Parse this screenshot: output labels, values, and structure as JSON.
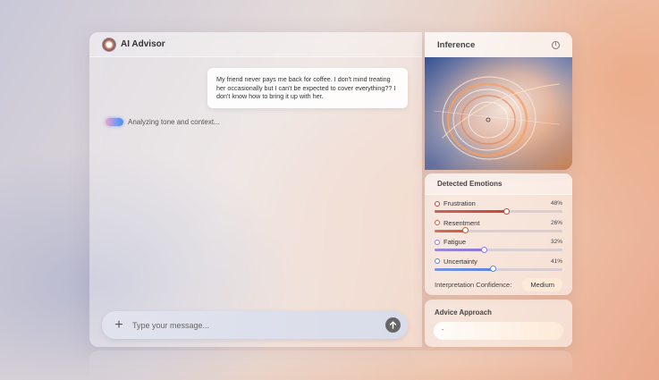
{
  "chat": {
    "title": "AI Advisor",
    "user_message": "My friend never pays me back for coffee. I don't mind treating her occasionally but I can't be expected to cover everything?? I don't know how to bring it up with her.",
    "status_text": "Analyzing tone and context...",
    "input_placeholder": "Type your message..."
  },
  "inference": {
    "title": "Inference",
    "info_icon": "i"
  },
  "emotions": {
    "title": "Detected Emotions",
    "items": [
      {
        "name": "Frustration",
        "value": "48%",
        "level": 0.56,
        "color": "#c8463a"
      },
      {
        "name": "Resentment",
        "value": "26%",
        "level": 0.24,
        "color": "#cf5a3a"
      },
      {
        "name": "Fatigue",
        "value": "32%",
        "level": 0.39,
        "color": "#8a78d8"
      },
      {
        "name": "Uncertainty",
        "value": "41%",
        "level": 0.46,
        "color": "#5b85e0"
      }
    ],
    "confidence_label": "Interpretation Confidence:",
    "confidence_value": "Medium"
  },
  "advice": {
    "title": "Advice Approach",
    "value": "-"
  }
}
